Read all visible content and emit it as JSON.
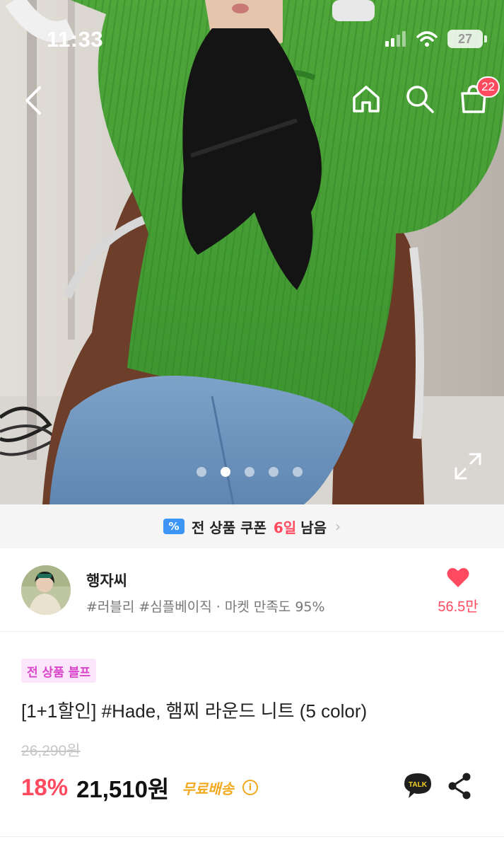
{
  "status_bar": {
    "time": "11:33",
    "battery": "27"
  },
  "nav": {
    "cart_count": "22"
  },
  "carousel": {
    "total": 5,
    "active_index": 1
  },
  "coupon": {
    "text": "전 상품 쿠폰",
    "days": "6일",
    "remain": "남음"
  },
  "shop": {
    "name": "행자씨",
    "meta": "#러블리 #심플베이직 · 마켓 만족도 95%",
    "likes": "56.5만"
  },
  "product": {
    "promo_tag": "전 상품 블프",
    "title": "[1+1할인] #Hade, 햄찌 라운드 니트 (5 color)",
    "original_price": "26,290원",
    "discount": "18%",
    "sale_price": "21,510원",
    "shipping": "무료배송"
  },
  "colors": {
    "accent": "#ff4a5f",
    "shipping": "#f2a81c",
    "promo": "#d844c9",
    "coupon_icon": "#3d96f5"
  }
}
